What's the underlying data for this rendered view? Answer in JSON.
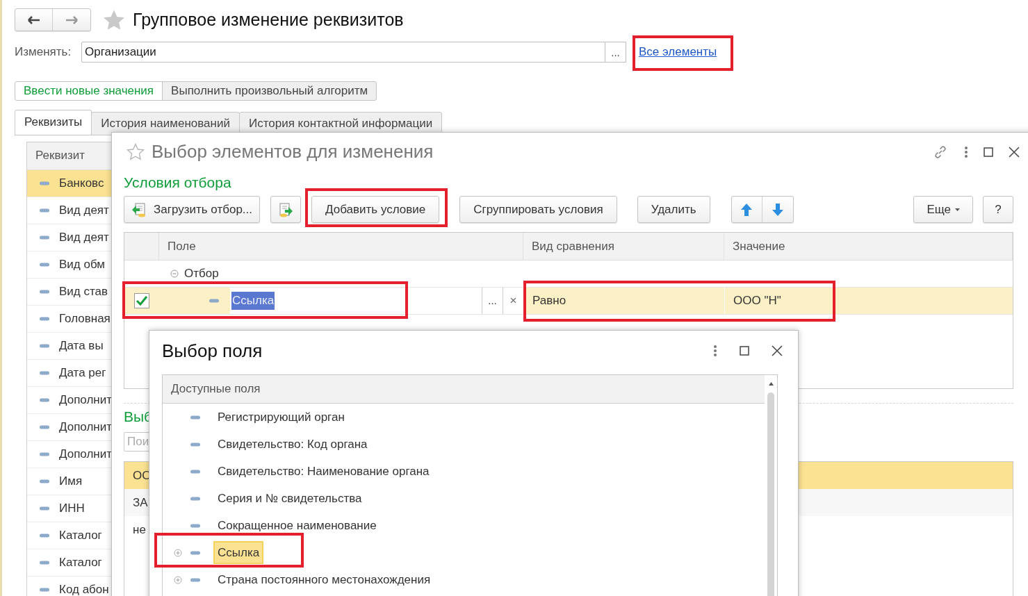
{
  "page": {
    "title": "Групповое изменение реквизитов"
  },
  "change": {
    "label": "Изменять:",
    "value": "Организации",
    "choose_button": "...",
    "link": "Все элементы"
  },
  "mode_buttons": [
    {
      "label": "Ввести новые значения",
      "selected": true
    },
    {
      "label": "Выполнить произвольный алгоритм",
      "selected": false
    }
  ],
  "tabs": [
    {
      "label": "Реквизиты",
      "selected": true
    },
    {
      "label": "История наименований",
      "selected": false
    },
    {
      "label": "История контактной информации",
      "selected": false
    }
  ],
  "attributes": {
    "column": "Реквизит",
    "rows": [
      {
        "label": "Банковс",
        "selected": true
      },
      {
        "label": "Вид деят",
        "selected": false
      },
      {
        "label": "Вид деят",
        "selected": false
      },
      {
        "label": "Вид обм",
        "selected": false
      },
      {
        "label": "Вид став",
        "selected": false
      },
      {
        "label": "Головная",
        "selected": false
      },
      {
        "label": "Дата вы",
        "selected": false
      },
      {
        "label": "Дата рег",
        "selected": false
      },
      {
        "label": "Дополнит",
        "selected": false
      },
      {
        "label": "Дополнит",
        "selected": false
      },
      {
        "label": "Дополнит",
        "selected": false
      },
      {
        "label": "Имя",
        "selected": false
      },
      {
        "label": "ИНН",
        "selected": false
      },
      {
        "label": "Каталог",
        "selected": false
      },
      {
        "label": "Каталог",
        "selected": false
      },
      {
        "label": "Код абон",
        "selected": false
      }
    ]
  },
  "selection_dialog": {
    "title": "Выбор элементов для изменения",
    "filter_heading": "Условия отбора",
    "toolbar": [
      {
        "kind": "load",
        "label": "Загрузить отбор..."
      },
      {
        "kind": "save"
      },
      {
        "kind": "text",
        "label": "Добавить условие"
      },
      {
        "kind": "text",
        "label": "Сгруппировать условия"
      },
      {
        "kind": "text",
        "label": "Удалить"
      },
      {
        "kind": "move"
      },
      {
        "kind": "menu",
        "label": "Еще"
      },
      {
        "kind": "text",
        "label": "?"
      }
    ],
    "filter_table": {
      "columns": [
        "Поле",
        "Вид сравнения",
        "Значение"
      ],
      "group": {
        "label": "Отбор",
        "expanded": true
      },
      "condition": {
        "checked": true,
        "selected": true,
        "field": "Ссылка",
        "choose_button": "...",
        "clear_button": "×",
        "comparison": "Равно",
        "value": "ООО \"Н\""
      }
    },
    "selection_heading": "Выб",
    "search": {
      "placeholder": "Пои"
    },
    "rows": [
      {
        "text": "ОО",
        "selected": true
      },
      {
        "text": "ЗА",
        "selected": false
      },
      {
        "text": "не",
        "selected": false
      }
    ]
  },
  "field_dialog": {
    "title": "Выбор поля",
    "column": "Доступные поля",
    "items": [
      {
        "label": "Регистрирующий орган",
        "expandable": false,
        "selected": false
      },
      {
        "label": "Свидетельство: Код органа",
        "expandable": false,
        "selected": false
      },
      {
        "label": "Свидетельство: Наименование органа",
        "expandable": false,
        "selected": false
      },
      {
        "label": "Серия и № свидетельства",
        "expandable": false,
        "selected": false
      },
      {
        "label": "Сокращенное наименование",
        "expandable": false,
        "selected": false
      },
      {
        "label": "Ссылка",
        "expandable": true,
        "selected": true
      },
      {
        "label": "Страна постоянного местонахождения",
        "expandable": true,
        "selected": false
      }
    ]
  }
}
